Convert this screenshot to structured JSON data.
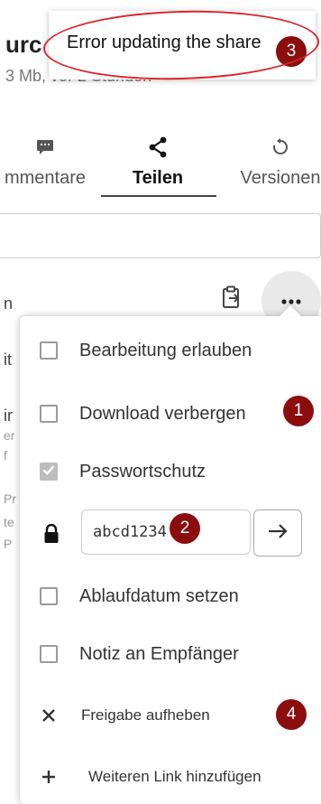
{
  "sidebar": {
    "title_fragment": "urc",
    "subtitle_fragment": "3 Mb, vor 2 Stunden",
    "tabs": [
      {
        "label": "mmentare",
        "icon": "comment-icon"
      },
      {
        "label": "Teilen",
        "icon": "share-icon",
        "active": true
      },
      {
        "label": "Versionen",
        "icon": "history-icon"
      }
    ],
    "fragments": [
      "n",
      "it",
      "ir",
      "er",
      "f",
      "Pr",
      "te",
      "P"
    ]
  },
  "toast": {
    "message": "Error updating the share"
  },
  "menu": {
    "items": [
      {
        "label": "Bearbeitung erlauben",
        "type": "checkbox",
        "checked": false
      },
      {
        "label": "Download verbergen",
        "type": "checkbox",
        "checked": false
      },
      {
        "label": "Passwortschutz",
        "type": "checkbox",
        "checked": true
      },
      {
        "label": "Ablaufdatum setzen",
        "type": "checkbox",
        "checked": false
      },
      {
        "label": "Notiz an Empfänger",
        "type": "checkbox",
        "checked": false
      },
      {
        "label": "Freigabe aufheben",
        "type": "action",
        "icon": "close-icon"
      },
      {
        "label": "Weiteren Link hinzufügen",
        "type": "action",
        "icon": "plus-icon"
      }
    ],
    "password": {
      "value": "abcd1234",
      "icon": "lock-icon",
      "submit_icon": "arrow-right-icon"
    }
  },
  "annotations": {
    "badges": [
      "1",
      "2",
      "3",
      "4"
    ],
    "badge_color": "#8b0d0d",
    "ring_color": "#d9252b"
  }
}
